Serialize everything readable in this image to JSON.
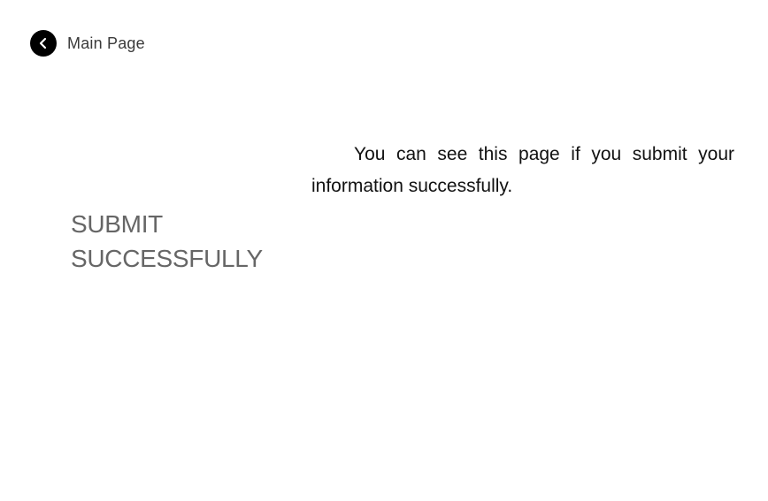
{
  "nav": {
    "back_label": "Main Page",
    "back_icon": "chevron-left-icon"
  },
  "headline": {
    "line1": "SUBMIT",
    "line2": "SUCCESSFULLY"
  },
  "message": {
    "text": "You can see this page if you submit your information successfully."
  },
  "colors": {
    "background": "#ffffff",
    "headline": "#666666",
    "body_text": "#111111",
    "back_icon_bg": "#000000"
  }
}
